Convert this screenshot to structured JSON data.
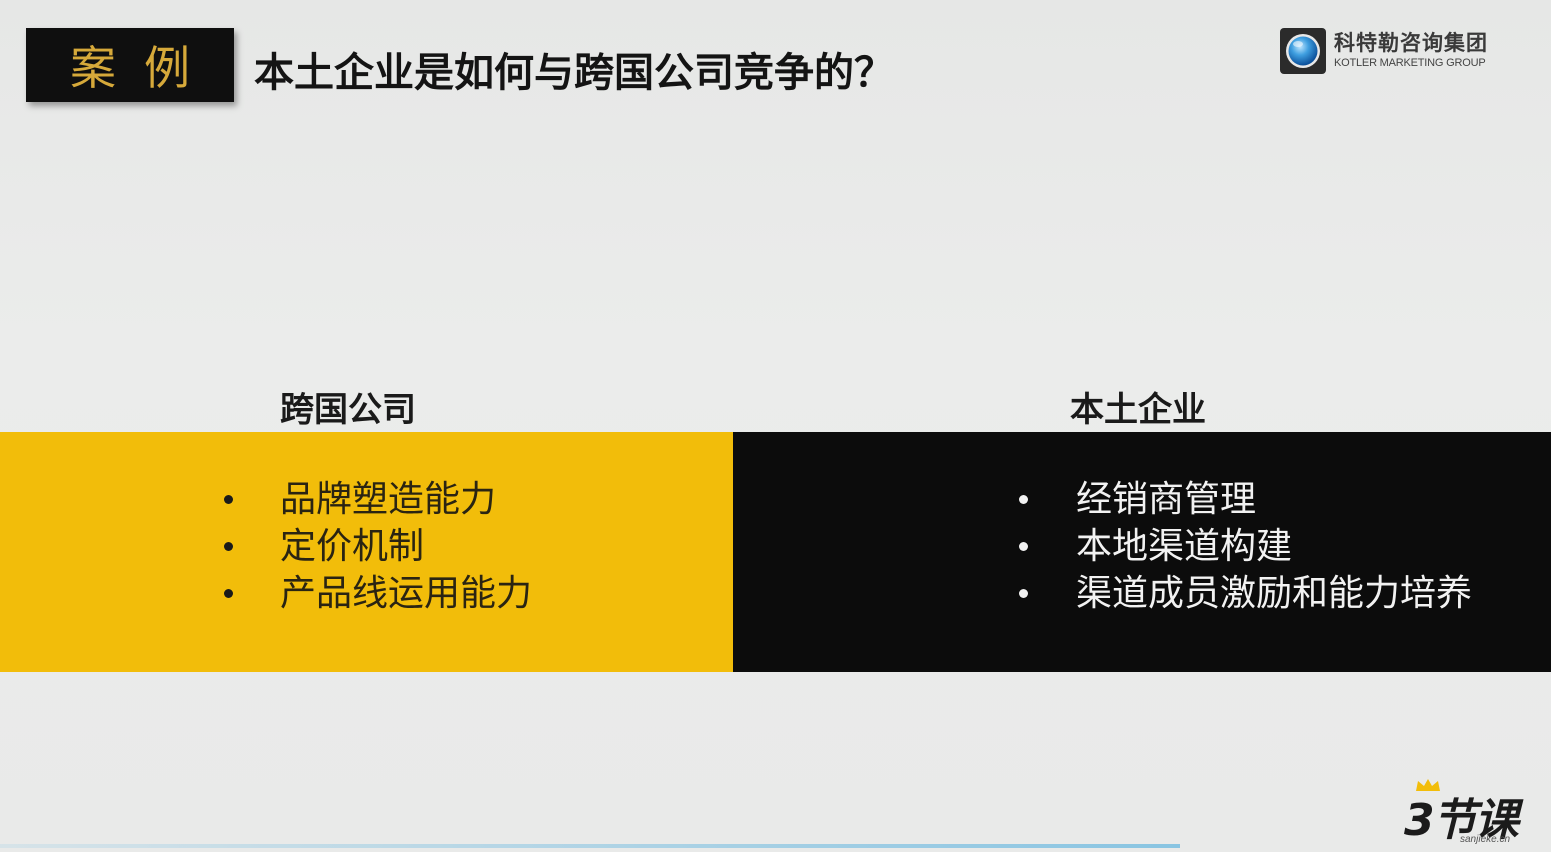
{
  "header": {
    "tag": "案例",
    "title": "本土企业是如何与跨国公司竞争的？"
  },
  "logo": {
    "name_cn": "科特勒咨询集团",
    "name_en": "KOTLER MARKETING GROUP",
    "icon": "globe-icon"
  },
  "columns": {
    "left": {
      "heading": "跨国公司",
      "color": "#f2bd0a",
      "items": [
        "品牌塑造能力",
        "定价机制",
        "产品线运用能力"
      ]
    },
    "right": {
      "heading": "本土企业",
      "color": "#0c0c0c",
      "items": [
        "经销商管理",
        "本地渠道构建",
        "渠道成员激励和能力培养"
      ]
    }
  },
  "watermark": {
    "main": "3节课",
    "sub": "sanjieke.cn",
    "icon": "crown-icon"
  }
}
